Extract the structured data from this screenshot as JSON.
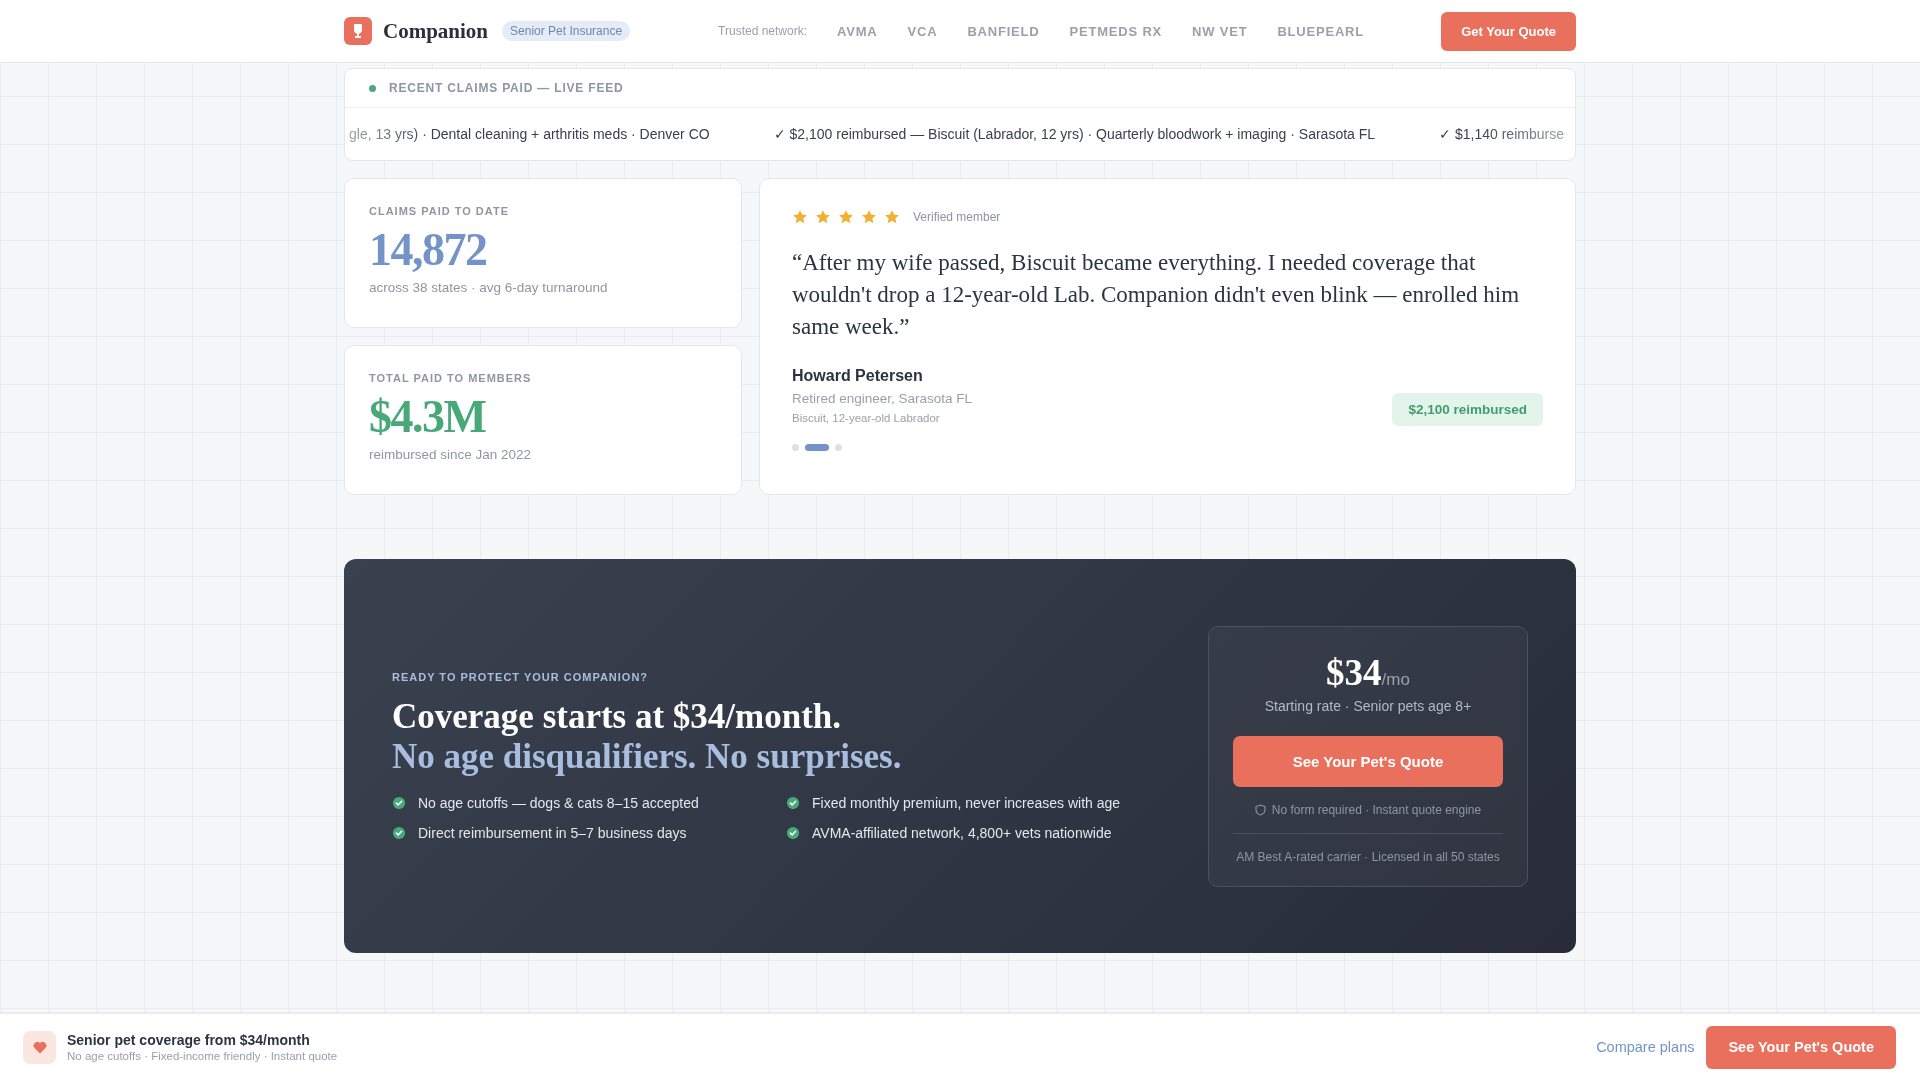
{
  "header": {
    "brand": "Companion",
    "badge": "Senior Pet Insurance",
    "network_label": "Trusted network:",
    "partners": [
      "AVMA",
      "VCA",
      "BANFIELD",
      "PETMEDS RX",
      "NW VET",
      "BLUEPEARL"
    ],
    "cta": "Get Your Quote"
  },
  "feed": {
    "title": "RECENT CLAIMS PAID — LIVE FEED",
    "items": [
      "gle, 13 yrs) · Dental cleaning + arthritis meds · Denver CO",
      "✓ $2,100 reimbursed — Biscuit (Labrador, 12 yrs) · Quarterly bloodwork + imaging · Sarasota FL",
      "✓ $1,140 reimburse"
    ]
  },
  "stats": [
    {
      "label": "CLAIMS PAID TO DATE",
      "value": "14,872",
      "note": "across 38 states · avg 6-day turnaround",
      "color": "#7393c9"
    },
    {
      "label": "TOTAL PAID TO MEMBERS",
      "value": "$4.3M",
      "note": "reimbursed since Jan 2022",
      "color": "#48a878"
    }
  ],
  "testimonial": {
    "stars": 5,
    "verified": "Verified member",
    "quote": "“After my wife passed, Biscuit became everything. I needed coverage that wouldn't drop a 12-year-old Lab. Companion didn't even blink — enrolled him same week.”",
    "name": "Howard Petersen",
    "role": "Retired engineer, Sarasota FL",
    "pet": "Biscuit, 12-year-old Labrador",
    "amount": "$2,100 reimbursed",
    "dots": [
      {
        "selected": false
      },
      {
        "selected": true
      },
      {
        "selected": false
      }
    ]
  },
  "cta": {
    "eyebrow": "READY TO PROTECT YOUR COMPANION?",
    "headline": "Coverage starts at $34/month.",
    "subhead": "No age disqualifiers. No surprises.",
    "features": [
      "No age cutoffs — dogs & cats 8–15 accepted",
      "Fixed monthly premium, never increases with age",
      "Direct reimbursement in 5–7 business days",
      "AVMA-affiliated network, 4,800+ vets nationwide"
    ],
    "price": "$34",
    "per": "/mo",
    "rate_note": "Starting rate · Senior pets age 8+",
    "button": "See Your Pet's Quote",
    "assurance": "No form required · Instant quote engine",
    "footnote": "AM Best A-rated carrier · Licensed in all 50 states"
  },
  "sticky_bar": {
    "title": "Senior pet coverage from $34/month",
    "subtitle": "No age cutoffs · Fixed-income friendly · Instant quote",
    "link": "Compare plans",
    "button": "See Your Pet's Quote"
  }
}
